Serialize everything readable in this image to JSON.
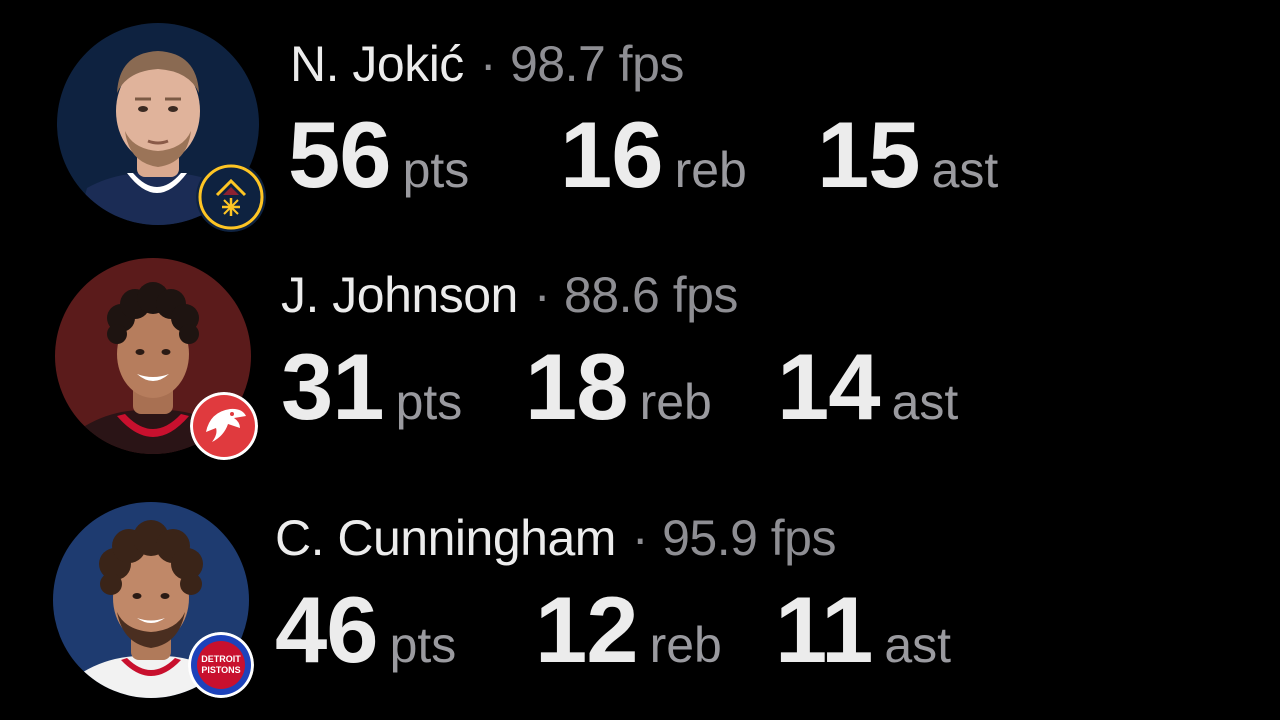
{
  "colors": {
    "background": "#000000",
    "primary_text": "#ececec",
    "secondary_text": "#8e8e93",
    "nuggets_navy": "#0e2240",
    "nuggets_gold": "#fec524",
    "hawks_red": "#e03a3e",
    "pistons_blue": "#1d42ba",
    "pistons_red": "#c8102e"
  },
  "separator": "·",
  "players": [
    {
      "name": "N. Jokić",
      "fps": "98.7 fps",
      "team_badge_icon": "denver-nuggets-logo-icon",
      "stats": [
        {
          "value": "56",
          "unit": "pts"
        },
        {
          "value": "16",
          "unit": "reb"
        },
        {
          "value": "15",
          "unit": "ast"
        }
      ]
    },
    {
      "name": "J. Johnson",
      "fps": "88.6 fps",
      "team_badge_icon": "atlanta-hawks-logo-icon",
      "stats": [
        {
          "value": "31",
          "unit": "pts"
        },
        {
          "value": "18",
          "unit": "reb"
        },
        {
          "value": "14",
          "unit": "ast"
        }
      ]
    },
    {
      "name": "C. Cunningham",
      "fps": "95.9 fps",
      "team_badge_icon": "detroit-pistons-logo-icon",
      "badge_text_line1": "DETROIT",
      "badge_text_line2": "PISTONS",
      "stats": [
        {
          "value": "46",
          "unit": "pts"
        },
        {
          "value": "12",
          "unit": "reb"
        },
        {
          "value": "11",
          "unit": "ast"
        }
      ]
    }
  ]
}
